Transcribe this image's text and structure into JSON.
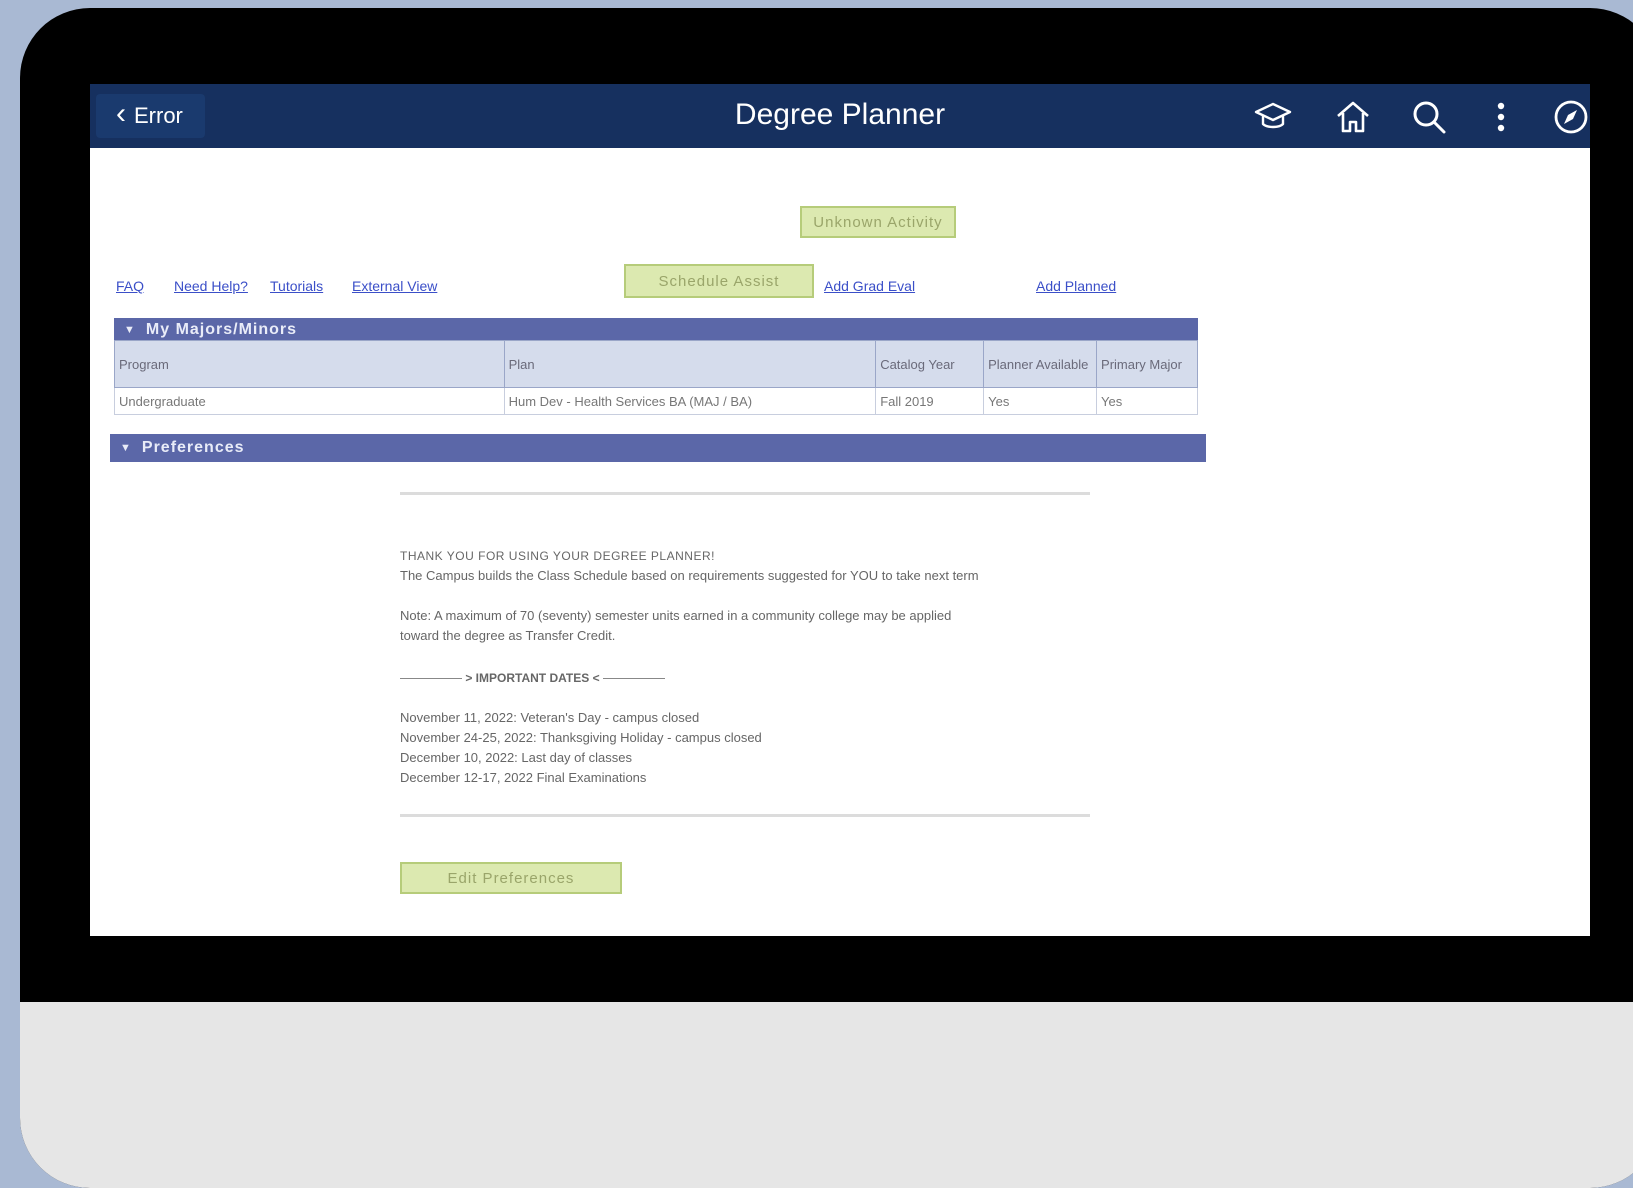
{
  "topbar": {
    "back_label": "Error",
    "title": "Degree Planner",
    "icons": [
      "graduation-cap-icon",
      "home-icon",
      "search-icon",
      "more-vertical-icon",
      "compass-icon"
    ]
  },
  "actions": {
    "unknown_button": "Unknown Activity",
    "schedule_button": "Schedule Assist",
    "grad_eval_link": "Add Grad Eval",
    "planned_link": "Add Planned"
  },
  "help_links": [
    "FAQ",
    "Need Help?",
    "Tutorials",
    "External View"
  ],
  "majors": {
    "title": "My Majors/Minors",
    "columns": [
      "Program",
      "Plan",
      "Catalog Year",
      "Planner Available",
      "Primary Major"
    ],
    "rows": [
      [
        "Undergraduate",
        "Hum Dev - Health Services BA (MAJ / BA)",
        "Fall 2019",
        "Yes",
        "Yes"
      ]
    ]
  },
  "preferences": {
    "title": "Preferences",
    "thanks_heading": "THANK YOU FOR USING YOUR DEGREE PLANNER!",
    "thanks_text": "The Campus builds the Class Schedule based on requirements suggested for YOU to take next term",
    "note_line1": "Note: A maximum of 70 (seventy) semester units earned in a community college may be applied",
    "note_line2": "toward the degree as Transfer Credit.",
    "important_dates_label": "> IMPORTANT DATES <",
    "dates": [
      "November 11, 2022: Veteran's Day - campus closed",
      "November 24-25, 2022: Thanksgiving Holiday - campus closed",
      "December 10, 2022: Last day of classes",
      "December 12-17, 2022 Final Examinations"
    ],
    "edit_button": "Edit Preferences"
  }
}
